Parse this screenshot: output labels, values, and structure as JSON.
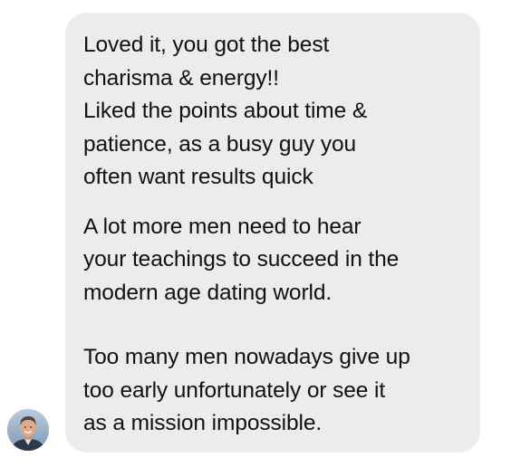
{
  "message": {
    "paragraphs": [
      {
        "lines": [
          "Loved it, you got the best",
          "charisma & energy!!",
          "Liked the points about time &",
          "patience, as a busy guy you",
          "often want results quick"
        ]
      },
      {
        "lines": [
          "A lot more men need to hear",
          "your teachings to succeed in the",
          "modern age dating world."
        ]
      },
      {
        "lines": [
          "Too many men nowadays give up",
          "too early unfortunately or see it",
          "as a mission impossible."
        ]
      }
    ],
    "bubble_color": "#ececed",
    "text_color": "#111111"
  },
  "sender": {
    "avatar_icon": "profile-photo"
  }
}
